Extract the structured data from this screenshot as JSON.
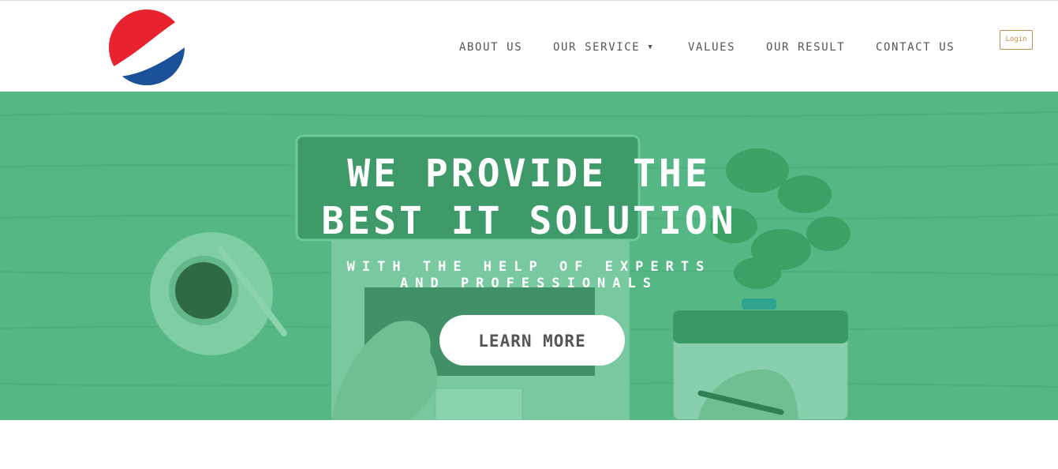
{
  "brand": {
    "logo_icon": "pepsi-globe-logo-icon",
    "colors": {
      "red": "#e8222e",
      "blue": "#1a5199",
      "white": "#ffffff"
    }
  },
  "nav": {
    "items": [
      {
        "label": "ABOUT US"
      },
      {
        "label": "OUR SERVICE",
        "dropdown_icon": "caret-down-icon"
      },
      {
        "label": "VALUES"
      },
      {
        "label": "OUR RESULT"
      },
      {
        "label": "CONTACT US"
      }
    ],
    "login_label": "Login"
  },
  "hero": {
    "title_line1": "WE PROVIDE THE",
    "title_line2": "BEST IT SOLUTION",
    "subtitle_line1": "WITH THE HELP OF EXPERTS",
    "subtitle_line2": "AND PROFESSIONALS",
    "cta_label": "LEARN MORE",
    "overlay_color": "#3fbf7a"
  }
}
